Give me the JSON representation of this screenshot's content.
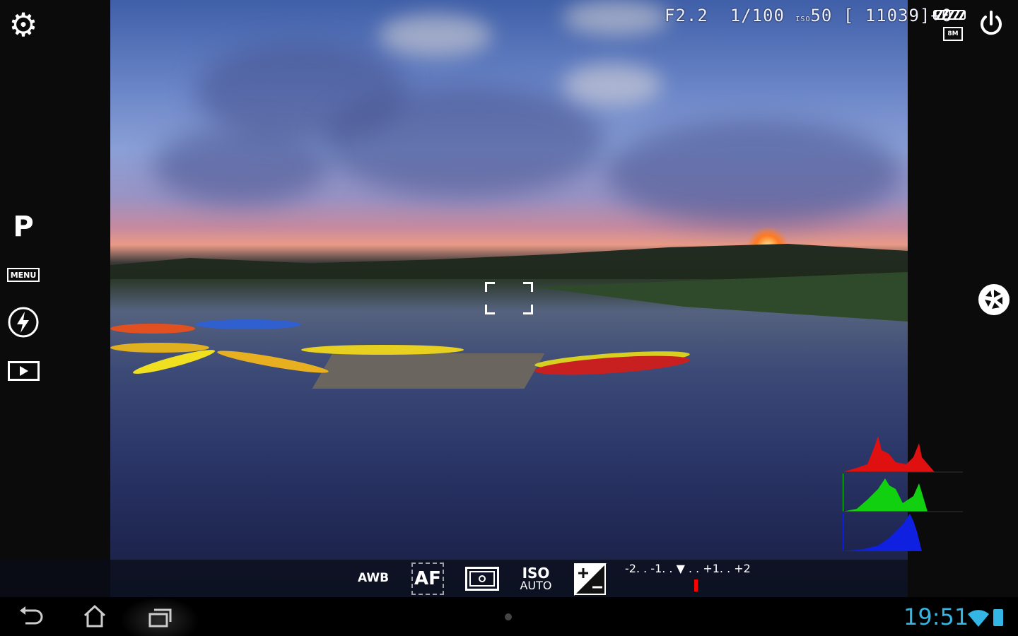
{
  "readout": {
    "aperture": "F2.2",
    "shutter": "1/100",
    "iso_label": "ISO",
    "iso": "50",
    "shots_remaining": "[ 11039]",
    "exposure_comp": "+0",
    "image_size": "8M"
  },
  "left_sidebar": {
    "mode": "P",
    "menu_label": "MENU"
  },
  "toolbar": {
    "white_balance": "AWB",
    "focus": "AF",
    "iso_top": "ISO",
    "iso_bottom": "AUTO",
    "ev_scale": "-2. . -1. . ▼ . . +1. . +2",
    "ev_value": 0
  },
  "status": {
    "time": "19:51"
  },
  "colors": {
    "accent": "#33b5e5",
    "ev_marker": "#ff0000",
    "hist_red": "#e01010",
    "hist_green": "#10d010",
    "hist_blue": "#1020e0"
  },
  "icons": [
    "gear-icon",
    "power-icon",
    "battery-icon",
    "shutter-icon",
    "flash-auto-icon",
    "playback-icon",
    "metering-icon",
    "exposure-comp-icon",
    "back-icon",
    "home-icon",
    "recent-apps-icon",
    "wifi-icon"
  ]
}
